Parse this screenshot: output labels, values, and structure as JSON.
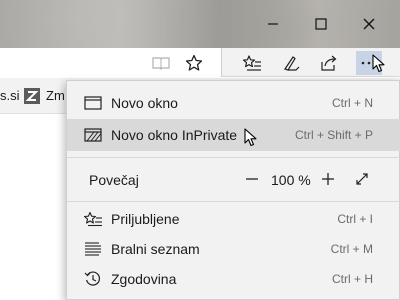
{
  "window_controls": {
    "minimize_icon": "minimize-icon",
    "maximize_icon": "maximize-icon",
    "close_icon": "close-icon"
  },
  "toolbar": {
    "icons": [
      "reading-view-icon",
      "favorite-star-icon",
      "favorites-hub-icon",
      "web-note-icon",
      "share-icon",
      "more-actions-icon"
    ]
  },
  "favorites_bar": {
    "item1": "s.si",
    "item2": "Zm"
  },
  "menu": {
    "items": [
      {
        "label": "Novo okno",
        "shortcut": "Ctrl + N",
        "icon": "new-window-icon"
      },
      {
        "label": "Novo okno InPrivate",
        "shortcut": "Ctrl + Shift + P",
        "icon": "inprivate-window-icon",
        "highlighted": true
      }
    ],
    "zoom": {
      "label": "Povečaj",
      "value": "100 %",
      "minus_icon": "zoom-out-icon",
      "plus_icon": "zoom-in-icon",
      "fullscreen_icon": "fullscreen-icon"
    },
    "lower_items": [
      {
        "label": "Priljubljene",
        "shortcut": "Ctrl + I",
        "icon": "favorites-icon"
      },
      {
        "label": "Bralni seznam",
        "shortcut": "Ctrl + M",
        "icon": "reading-list-icon"
      },
      {
        "label": "Zgodovina",
        "shortcut": "Ctrl + H",
        "icon": "history-icon"
      }
    ]
  },
  "colors": {
    "menu_background": "#f2f2f2",
    "highlight": "#d9d9d9",
    "more_button_active": "#c8d3e6"
  }
}
